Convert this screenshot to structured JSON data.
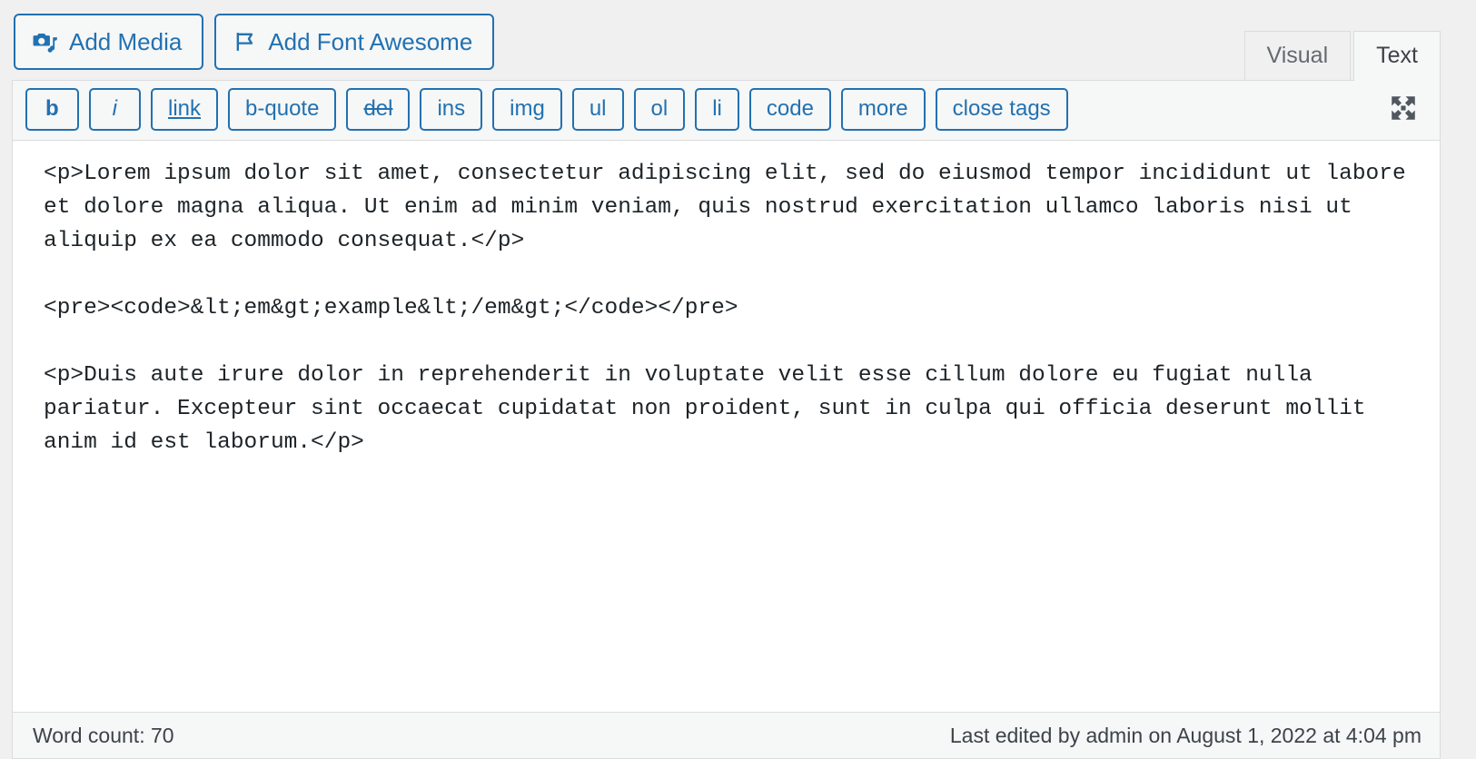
{
  "media_bar": {
    "buttons": [
      {
        "label": "Add Media",
        "icon": "camera-music-icon"
      },
      {
        "label": "Add Font Awesome",
        "icon": "flag-icon"
      }
    ]
  },
  "tabs": [
    {
      "label": "Visual",
      "active": false
    },
    {
      "label": "Text",
      "active": true
    }
  ],
  "toolbar": {
    "buttons": [
      {
        "label": "b",
        "style": "bold"
      },
      {
        "label": "i",
        "style": "italic"
      },
      {
        "label": "link",
        "style": "underline"
      },
      {
        "label": "b-quote",
        "style": "plain"
      },
      {
        "label": "del",
        "style": "strike"
      },
      {
        "label": "ins",
        "style": "plain"
      },
      {
        "label": "img",
        "style": "plain"
      },
      {
        "label": "ul",
        "style": "plain"
      },
      {
        "label": "ol",
        "style": "plain"
      },
      {
        "label": "li",
        "style": "plain"
      },
      {
        "label": "code",
        "style": "plain"
      },
      {
        "label": "more",
        "style": "plain"
      },
      {
        "label": "close tags",
        "style": "plain"
      }
    ],
    "fullscreen_icon": "fullscreen-expand-icon"
  },
  "content": {
    "value": "<p>Lorem ipsum dolor sit amet, consectetur adipiscing elit, sed do eiusmod tempor incididunt ut labore et dolore magna aliqua. Ut enim ad minim veniam, quis nostrud exercitation ullamco laboris nisi ut aliquip ex ea commodo consequat.</p>\n\n<pre><code>&lt;em&gt;example&lt;/em&gt;</code></pre>\n\n<p>Duis aute irure dolor in reprehenderit in voluptate velit esse cillum dolore eu fugiat nulla pariatur. Excepteur sint occaecat cupidatat non proident, sunt in culpa qui officia deserunt mollit anim id est laborum.</p>"
  },
  "footer": {
    "word_count": "Word count: 70",
    "last_edited": "Last edited by admin on August 1, 2022 at 4:04 pm"
  },
  "colors": {
    "accent_blue": "#2271b1",
    "panel_bg": "#f6f7f7",
    "page_bg": "#f0f0f1",
    "border": "#dcdcde",
    "text": "#1d2327",
    "muted_text": "#646970"
  }
}
